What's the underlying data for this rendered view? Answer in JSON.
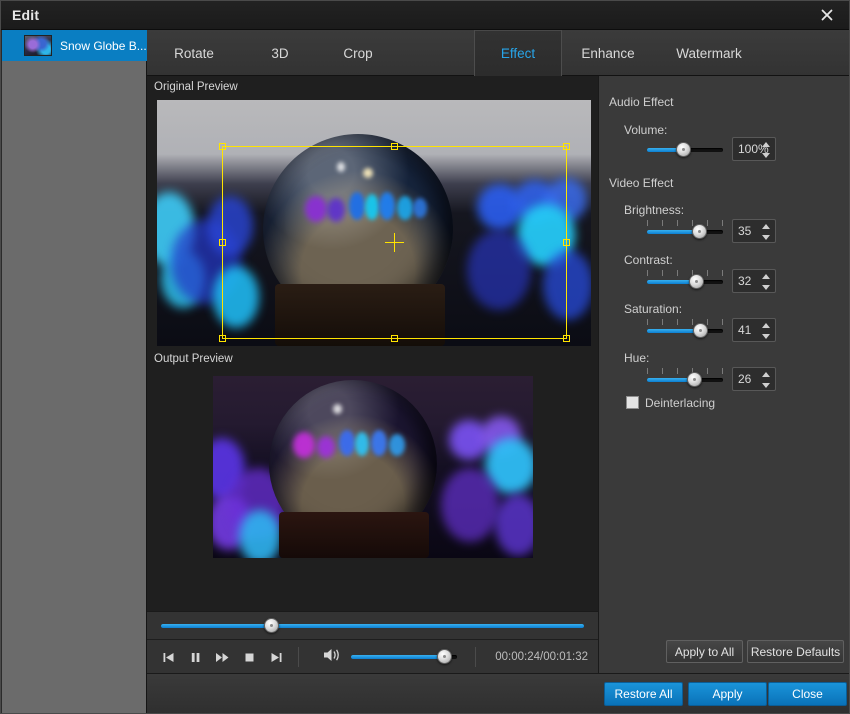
{
  "window": {
    "title": "Edit",
    "close_icon": "close-icon"
  },
  "sidebar": {
    "items": [
      {
        "label": "Snow Globe B...",
        "selected": true
      }
    ]
  },
  "tabs": [
    {
      "label": "Rotate",
      "active": false
    },
    {
      "label": "3D",
      "active": false
    },
    {
      "label": "Crop",
      "active": false
    },
    {
      "label": "Effect",
      "active": true
    },
    {
      "label": "Enhance",
      "active": false
    },
    {
      "label": "Watermark",
      "active": false
    }
  ],
  "preview": {
    "original_label": "Original Preview",
    "output_label": "Output Preview"
  },
  "transport": {
    "timeline_percent": 26,
    "buttons": [
      {
        "name": "previous-button",
        "icon": "skip-previous-icon"
      },
      {
        "name": "pause-button",
        "icon": "pause-icon"
      },
      {
        "name": "fast-forward-button",
        "icon": "fast-forward-icon"
      },
      {
        "name": "stop-button",
        "icon": "stop-icon"
      },
      {
        "name": "next-button",
        "icon": "skip-next-icon"
      }
    ],
    "volume_icon": "speaker-icon",
    "volume_percent": 88,
    "timecode": "00:00:24/00:01:32"
  },
  "audio_effect": {
    "group_label": "Audio Effect",
    "volume": {
      "label": "Volume:",
      "value": "100%",
      "slider_percent": 48
    }
  },
  "video_effect": {
    "group_label": "Video Effect",
    "brightness": {
      "label": "Brightness:",
      "value": "35",
      "slider_percent": 68
    },
    "contrast": {
      "label": "Contrast:",
      "value": "32",
      "slider_percent": 65
    },
    "saturation": {
      "label": "Saturation:",
      "value": "41",
      "slider_percent": 70
    },
    "hue": {
      "label": "Hue:",
      "value": "26",
      "slider_percent": 62
    },
    "deinterlacing": {
      "label": "Deinterlacing",
      "checked": false
    }
  },
  "panel_buttons": {
    "apply_to_all": "Apply to All",
    "restore_defaults": "Restore Defaults"
  },
  "footer_buttons": {
    "restore_all": "Restore All",
    "apply": "Apply",
    "close": "Close"
  },
  "colors": {
    "accent": "#1a94da",
    "tab_active_text": "#27a4e8",
    "selection": "#ffe400",
    "sidebar_selected": "#0a7ec2"
  }
}
